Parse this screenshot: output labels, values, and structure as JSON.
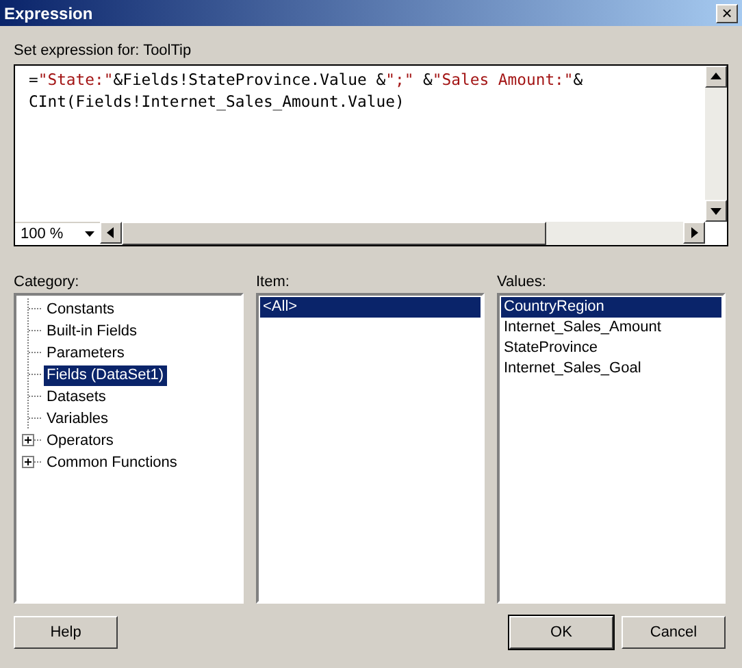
{
  "window": {
    "title": "Expression",
    "close": "×"
  },
  "expression": {
    "label": "Set expression for: ToolTip",
    "lines": [
      [
        {
          "kind": "plain",
          "text": "="
        },
        {
          "kind": "string",
          "text": "\"State:\""
        },
        {
          "kind": "plain",
          "text": "&Fields!StateProvince.Value &"
        },
        {
          "kind": "string",
          "text": "\";\""
        },
        {
          "kind": "plain",
          "text": " &"
        },
        {
          "kind": "string",
          "text": "\"Sales Amount:\""
        },
        {
          "kind": "plain",
          "text": "&"
        }
      ],
      [
        {
          "kind": "plain",
          "text": "CInt(Fields!Internet_Sales_Amount.Value)"
        }
      ]
    ],
    "zoom": "100 %"
  },
  "category": {
    "label": "Category:",
    "items": [
      {
        "kind": "leaf",
        "label": "Constants",
        "selected": false
      },
      {
        "kind": "leaf",
        "label": "Built-in Fields",
        "selected": false
      },
      {
        "kind": "leaf",
        "label": "Parameters",
        "selected": false
      },
      {
        "kind": "leaf",
        "label": "Fields (DataSet1)",
        "selected": true
      },
      {
        "kind": "leaf",
        "label": "Datasets",
        "selected": false
      },
      {
        "kind": "leaf",
        "label": "Variables",
        "selected": false
      },
      {
        "kind": "group",
        "label": "Operators",
        "selected": false,
        "expanded": false
      },
      {
        "kind": "group",
        "label": "Common Functions",
        "selected": false,
        "expanded": false
      }
    ]
  },
  "item": {
    "label": "Item:",
    "items": [
      {
        "label": "<All>",
        "selected": true
      }
    ]
  },
  "values": {
    "label": "Values:",
    "items": [
      {
        "label": "CountryRegion",
        "selected": true
      },
      {
        "label": "Internet_Sales_Amount",
        "selected": false
      },
      {
        "label": "StateProvince",
        "selected": false
      },
      {
        "label": "Internet_Sales_Goal",
        "selected": false
      }
    ]
  },
  "buttons": {
    "help": "Help",
    "ok": "OK",
    "cancel": "Cancel"
  }
}
